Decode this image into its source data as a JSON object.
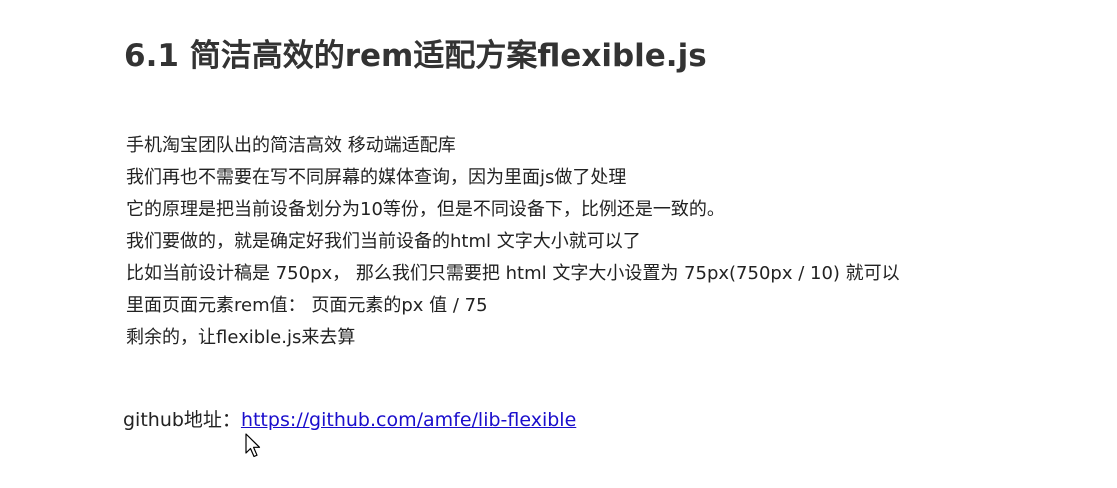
{
  "slide": {
    "title": "6.1 简洁高效的rem适配方案flexible.js",
    "lines": [
      "手机淘宝团队出的简洁高效 移动端适配库",
      "我们再也不需要在写不同屏幕的媒体查询，因为里面js做了处理",
      "它的原理是把当前设备划分为10等份，但是不同设备下，比例还是一致的。",
      "我们要做的，就是确定好我们当前设备的html 文字大小就可以了",
      "比如当前设计稿是 750px， 那么我们只需要把 html 文字大小设置为 75px(750px / 10) 就可以",
      "里面页面元素rem值： 页面元素的px 值 /  75",
      "剩余的，让flexible.js来去算"
    ],
    "github_label": "github地址：",
    "github_link": "https://github.com/amfe/lib-flexible",
    "cursor_icon": "mouse-pointer-icon"
  }
}
